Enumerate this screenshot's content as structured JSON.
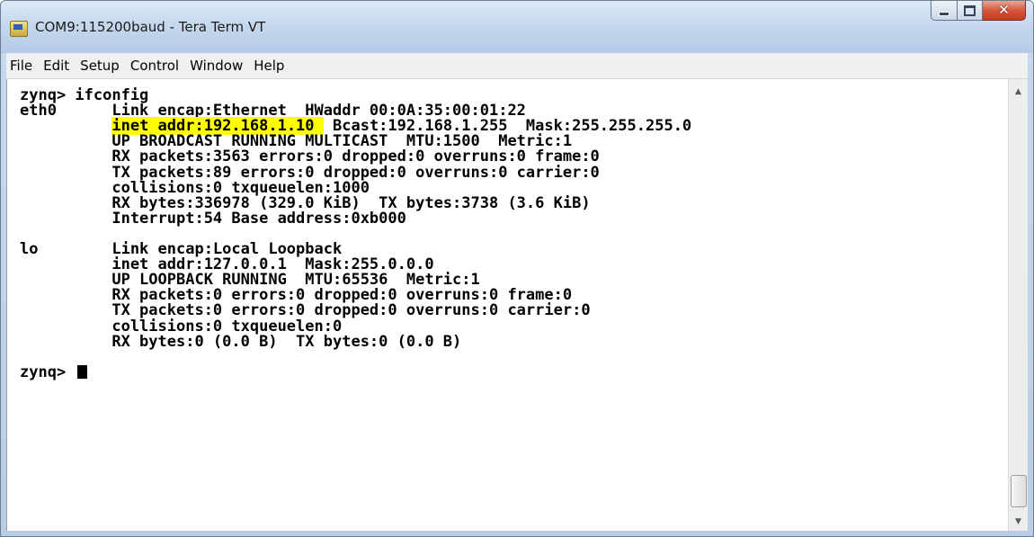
{
  "window": {
    "title": "COM9:115200baud - Tera Term VT"
  },
  "menu": [
    "File",
    "Edit",
    "Setup",
    "Control",
    "Window",
    "Help"
  ],
  "terminal": {
    "lines": [
      "zynq> ifconfig",
      "eth0      Link encap:Ethernet  HWaddr 00:0A:35:00:01:22",
      {
        "indent": "          ",
        "highlight": "inet addr:192.168.1.10 ",
        "rest": " Bcast:192.168.1.255  Mask:255.255.255.0"
      },
      "          UP BROADCAST RUNNING MULTICAST  MTU:1500  Metric:1",
      "          RX packets:3563 errors:0 dropped:0 overruns:0 frame:0",
      "          TX packets:89 errors:0 dropped:0 overruns:0 carrier:0",
      "          collisions:0 txqueuelen:1000",
      "          RX bytes:336978 (329.0 KiB)  TX bytes:3738 (3.6 KiB)",
      "          Interrupt:54 Base address:0xb000",
      "",
      "lo        Link encap:Local Loopback",
      "          inet addr:127.0.0.1  Mask:255.0.0.0",
      "          UP LOOPBACK RUNNING  MTU:65536  Metric:1",
      "          RX packets:0 errors:0 dropped:0 overruns:0 frame:0",
      "          TX packets:0 errors:0 dropped:0 overruns:0 carrier:0",
      "          collisions:0 txqueuelen:0",
      "          RX bytes:0 (0.0 B)  TX bytes:0 (0.0 B)",
      "",
      "zynq> "
    ]
  },
  "colors": {
    "highlight": "#ffff00",
    "text": "#000000",
    "background": "#ffffff",
    "close_button": "#c33a20"
  }
}
